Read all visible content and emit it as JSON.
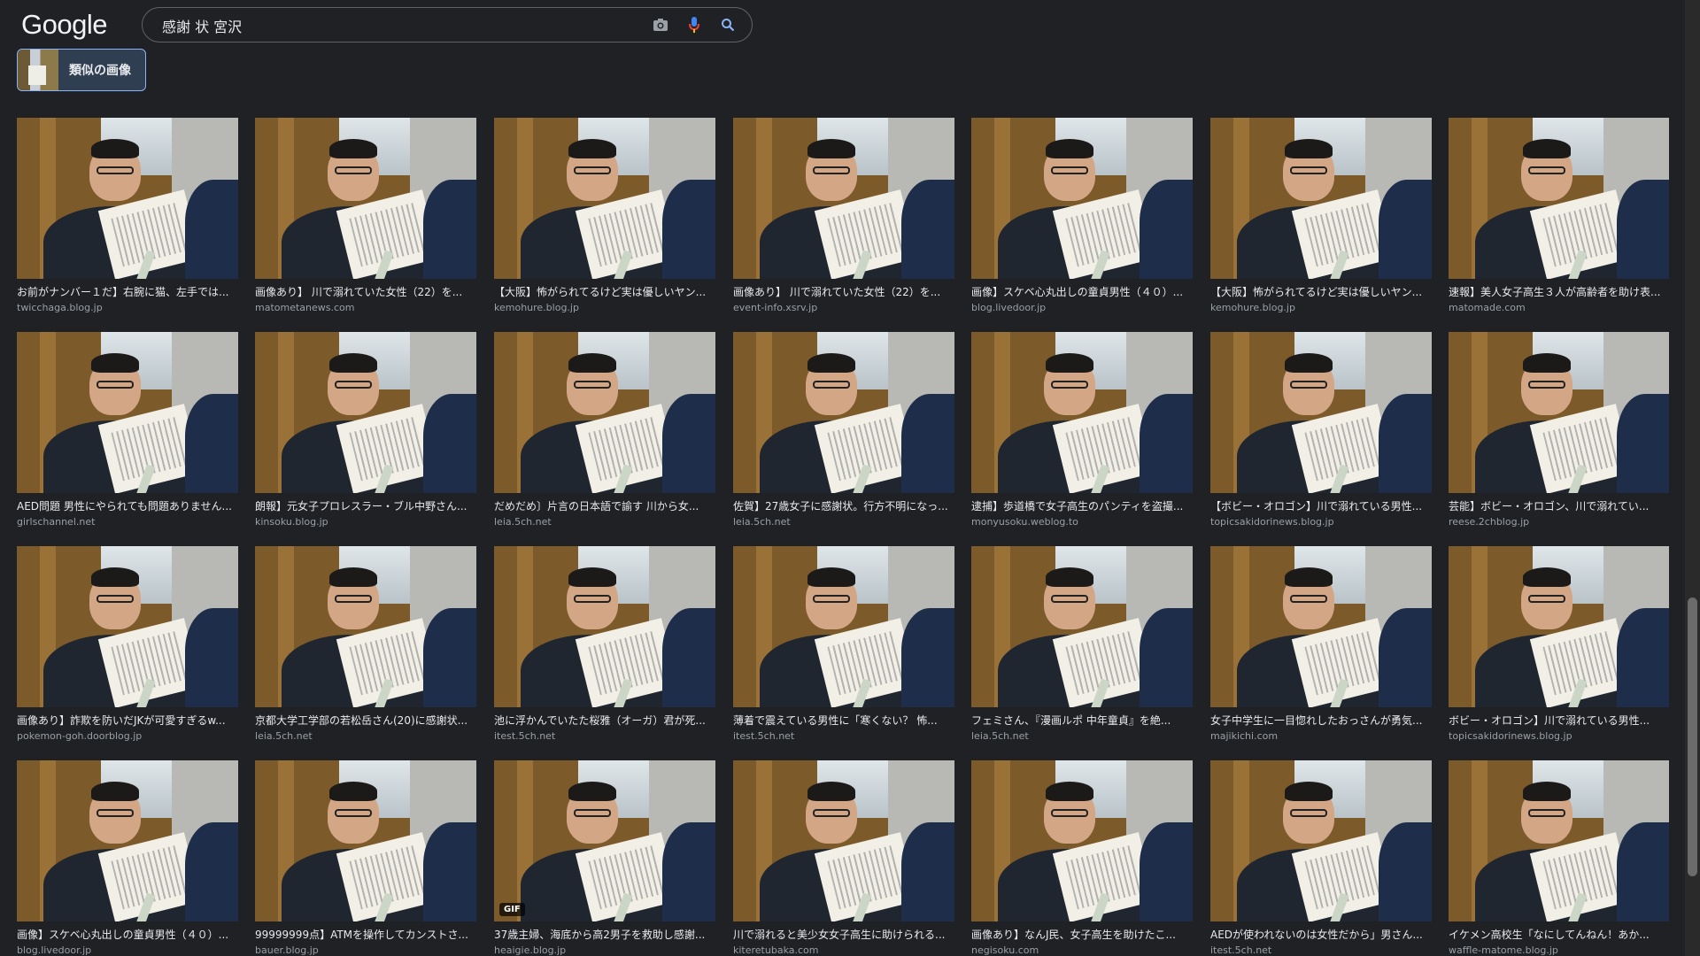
{
  "header": {
    "logo": "Google",
    "search_query": "感謝 状 宮沢",
    "camera_icon": "camera-icon",
    "mic_icon": "mic-icon",
    "search_icon": "search-icon"
  },
  "similar": {
    "label": "類似の画像"
  },
  "results": [
    {
      "caption": "お前がナンバー１だ】右腕に猫、左手では...",
      "source": "twicchaga.blog.jp"
    },
    {
      "caption": "画像あり】 川で溺れていた女性（22）を...",
      "source": "matometanews.com"
    },
    {
      "caption": "【大阪】怖がられてるけど実は優しいヤン...",
      "source": "kemohure.blog.jp"
    },
    {
      "caption": "画像あり】 川で溺れていた女性（22）を...",
      "source": "event-info.xsrv.jp"
    },
    {
      "caption": "画像】スケベ心丸出しの童貞男性（４０）...",
      "source": "blog.livedoor.jp"
    },
    {
      "caption": "【大阪】怖がられてるけど実は優しいヤン...",
      "source": "kemohure.blog.jp"
    },
    {
      "caption": "速報】美人女子高生３人が高齢者を助け表...",
      "source": "matomade.com"
    },
    {
      "caption": "AED問題 男性にやられても問題ありません...",
      "source": "girlschannel.net"
    },
    {
      "caption": "朗報】元女子プロレスラー・ブル中野さん...",
      "source": "kinsoku.blog.jp"
    },
    {
      "caption": "だめだめ〕片言の日本語で諭す 川から女...",
      "source": "leia.5ch.net"
    },
    {
      "caption": "佐賀】27歳女子に感謝状。行方不明になっ...",
      "source": "leia.5ch.net"
    },
    {
      "caption": "逮捕】歩道橋で女子高生のパンティを盗撮...",
      "source": "monyusoku.weblog.to"
    },
    {
      "caption": "【ボビー・オロゴン】川で溺れている男性...",
      "source": "topicsakidorinews.blog.jp"
    },
    {
      "caption": "芸能】ボビー・オロゴン、川で溺れてい...",
      "source": "reese.2chblog.jp"
    },
    {
      "caption": "画像あり】詐欺を防いだJKが可愛すぎるw...",
      "source": "pokemon-goh.doorblog.jp"
    },
    {
      "caption": "京都大学工学部の若松岳さん(20)に感謝状...",
      "source": "leia.5ch.net"
    },
    {
      "caption": "池に浮かんでいたた桜雅（オーガ）君が死...",
      "source": "itest.5ch.net"
    },
    {
      "caption": "薄着で震えている男性に「寒くない？ 怖...",
      "source": "itest.5ch.net"
    },
    {
      "caption": "フェミさん、『漫画ルポ 中年童貞』を絶...",
      "source": "leia.5ch.net"
    },
    {
      "caption": "女子中学生に一目惚れしたおっさんが勇気...",
      "source": "majikichi.com"
    },
    {
      "caption": "ボビー・オロゴン】川で溺れている男性...",
      "source": "topicsakidorinews.blog.jp"
    },
    {
      "caption": "画像】スケベ心丸出しの童貞男性（４０）...",
      "source": "blog.livedoor.jp"
    },
    {
      "caption": "99999999点】ATMを操作してカンストさ...",
      "source": "bauer.blog.jp"
    },
    {
      "caption": "37歳主婦、海底から高2男子を救助し感謝...",
      "source": "heaigie.blog.jp",
      "badge": "GIF"
    },
    {
      "caption": "川で溺れると美少女女子高生に助けられる...",
      "source": "kiteretubaka.com"
    },
    {
      "caption": "画像あり】なんJ民、女子高生を助けたこ...",
      "source": "negisoku.com"
    },
    {
      "caption": "AEDが使われないのは女性だから」男さん...",
      "source": "itest.5ch.net"
    },
    {
      "caption": "イケメン高校生「なにしてんねん！あか...",
      "source": "waffle-matome.blog.jp"
    }
  ]
}
